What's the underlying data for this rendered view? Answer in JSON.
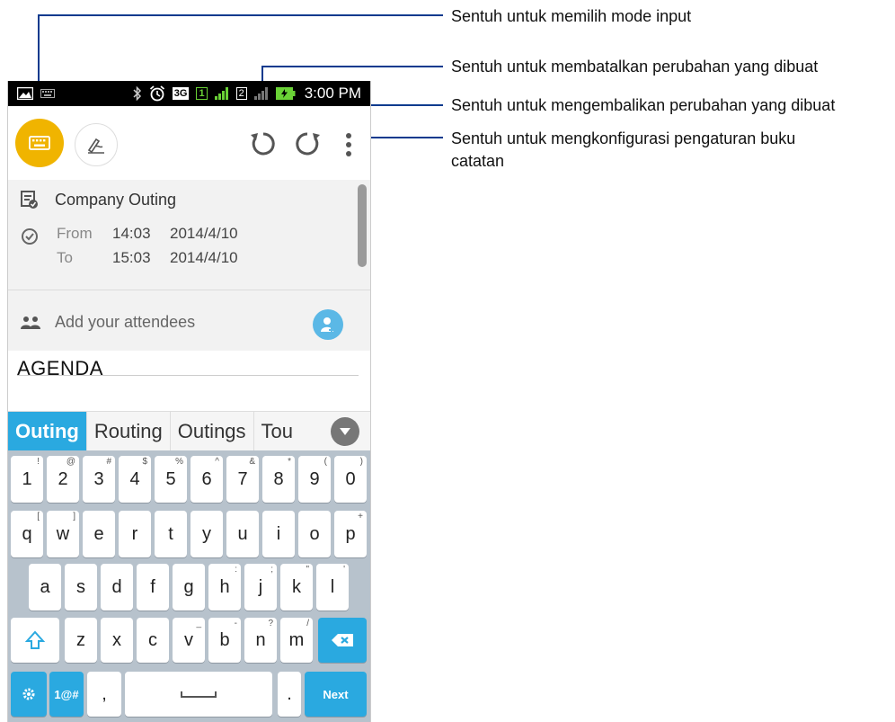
{
  "status_bar": {
    "network_label": "3G",
    "sim_slot_1": "1",
    "sim_slot_2": "2",
    "time": "3:00 PM"
  },
  "event": {
    "title": "Company Outing",
    "from_label": "From",
    "from_time": "14:03",
    "from_date": "2014/4/10",
    "to_label": "To",
    "to_time": "15:03",
    "to_date": "2014/4/10",
    "attendees_placeholder": "Add your attendees"
  },
  "note": {
    "text": "AGENDA"
  },
  "suggestions": [
    "Outing",
    "Routing",
    "Outings",
    "Tou"
  ],
  "keyboard": {
    "number_row": [
      {
        "k": "1",
        "s": "!"
      },
      {
        "k": "2",
        "s": "@"
      },
      {
        "k": "3",
        "s": "#"
      },
      {
        "k": "4",
        "s": "$"
      },
      {
        "k": "5",
        "s": "%"
      },
      {
        "k": "6",
        "s": "^"
      },
      {
        "k": "7",
        "s": "&"
      },
      {
        "k": "8",
        "s": "*"
      },
      {
        "k": "9",
        "s": "("
      },
      {
        "k": "0",
        "s": ")"
      }
    ],
    "row1": [
      {
        "k": "q",
        "s": "["
      },
      {
        "k": "w",
        "s": "]"
      },
      {
        "k": "e",
        "s": ""
      },
      {
        "k": "r",
        "s": ""
      },
      {
        "k": "t",
        "s": ""
      },
      {
        "k": "y",
        "s": ""
      },
      {
        "k": "u",
        "s": ""
      },
      {
        "k": "i",
        "s": ""
      },
      {
        "k": "o",
        "s": ""
      },
      {
        "k": "p",
        "s": "+"
      }
    ],
    "row2": [
      {
        "k": "a",
        "s": ""
      },
      {
        "k": "s",
        "s": ""
      },
      {
        "k": "d",
        "s": ""
      },
      {
        "k": "f",
        "s": ""
      },
      {
        "k": "g",
        "s": ""
      },
      {
        "k": "h",
        "s": ":"
      },
      {
        "k": "j",
        "s": ";"
      },
      {
        "k": "k",
        "s": "\""
      },
      {
        "k": "l",
        "s": "'"
      }
    ],
    "row3": [
      {
        "k": "z",
        "s": ""
      },
      {
        "k": "x",
        "s": ""
      },
      {
        "k": "c",
        "s": ""
      },
      {
        "k": "v",
        "s": "_"
      },
      {
        "k": "b",
        "s": "-"
      },
      {
        "k": "n",
        "s": "?"
      },
      {
        "k": "m",
        "s": "/"
      }
    ],
    "symbols_label": "1@#",
    "comma_label": ",",
    "period_label": ".",
    "next_label": "Next"
  },
  "callouts": {
    "input_mode": "Sentuh untuk memilih mode input",
    "undo": "Sentuh untuk membatalkan perubahan yang dibuat",
    "redo": "Sentuh untuk mengembalikan perubahan yang dibuat",
    "settings_line1": "Sentuh untuk mengkonfigurasi pengaturan buku",
    "settings_line2": "catatan"
  },
  "colors": {
    "accent_yellow": "#f0b400",
    "accent_blue": "#2aa9e0",
    "callout_line": "#0b3a8e"
  }
}
